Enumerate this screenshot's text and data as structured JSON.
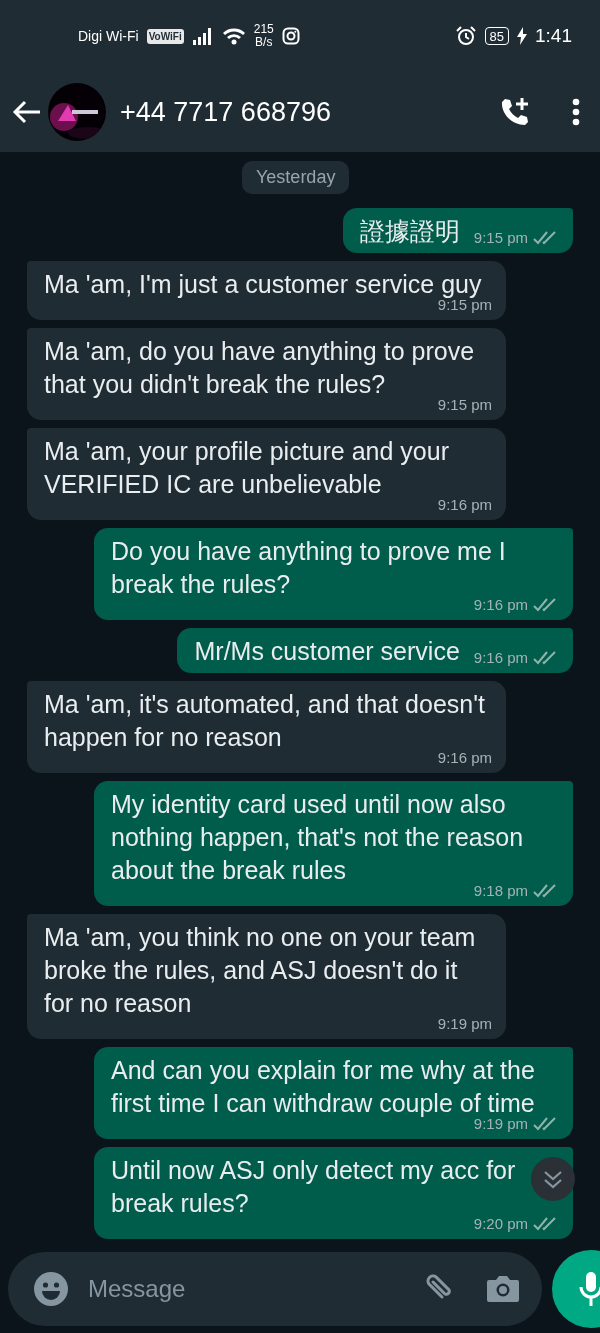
{
  "status_bar": {
    "carrier": "Digi Wi-Fi",
    "vowifi": "VoWiFi",
    "speed_value": "215",
    "speed_unit": "B/s",
    "battery": "85",
    "charging": true,
    "time": "1:41"
  },
  "header": {
    "title": "+44 7717 668796"
  },
  "date_chip": "Yesterday",
  "messages": [
    {
      "kind": "outgoing",
      "text": "證據證明",
      "time": "9:15 pm",
      "read": false
    },
    {
      "kind": "incoming",
      "text": "Ma 'am, I'm just a customer service guy",
      "time": "9:15 pm"
    },
    {
      "kind": "incoming",
      "text": "Ma 'am, do you have anything to prove that you didn't break the rules?",
      "time": "9:15 pm"
    },
    {
      "kind": "incoming",
      "text": "Ma 'am, your profile picture and your VERIFIED IC are unbelievable",
      "time": "9:16 pm"
    },
    {
      "kind": "outgoing",
      "text": "Do you have anything to prove me I break the rules?",
      "time": "9:16 pm",
      "read": false
    },
    {
      "kind": "outgoing",
      "text": "Mr/Ms customer service",
      "time": "9:16 pm",
      "read": false
    },
    {
      "kind": "incoming",
      "text": "Ma 'am, it's automated, and that doesn't happen for no reason",
      "time": "9:16 pm"
    },
    {
      "kind": "outgoing",
      "text": "My identity card used until now also nothing happen, that's not the reason about  the break rules",
      "time": "9:18 pm",
      "read": false
    },
    {
      "kind": "incoming",
      "text": "Ma 'am, you think no one on your team broke the rules, and ASJ doesn't do it for no reason",
      "time": "9:19 pm"
    },
    {
      "kind": "outgoing",
      "text": "And can you explain for me why at the first time I can withdraw couple of time",
      "time": "9:19 pm",
      "read": false
    },
    {
      "kind": "outgoing",
      "text": "Until now ASJ only detect my acc for break rules?",
      "time": "9:20 pm",
      "read": false
    }
  ],
  "composer": {
    "placeholder": "Message"
  }
}
